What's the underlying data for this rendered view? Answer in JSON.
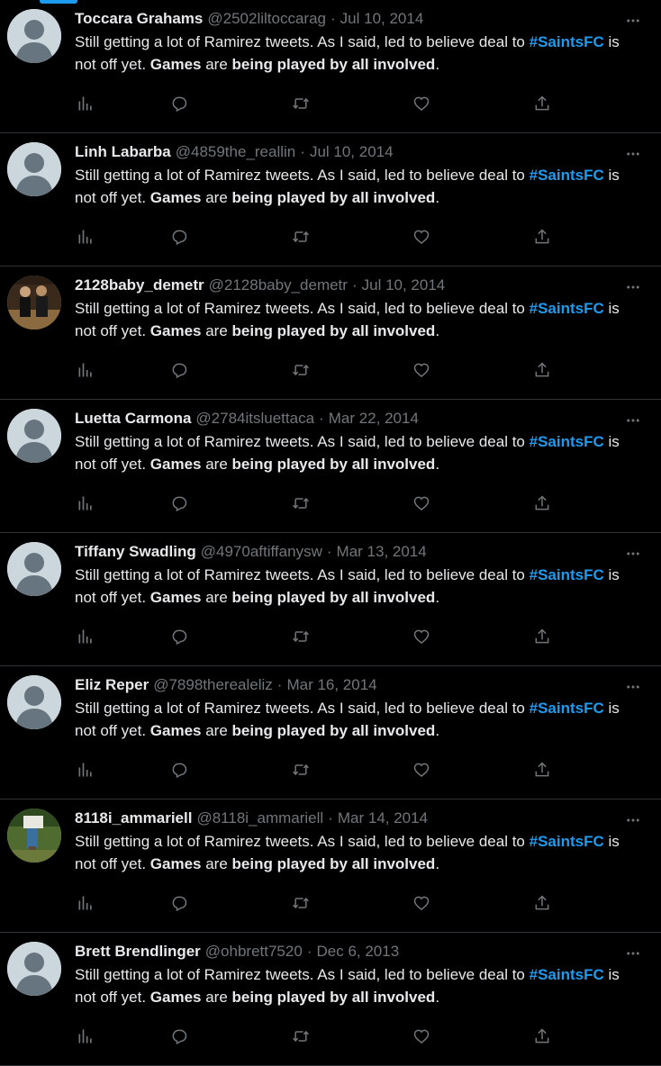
{
  "colors": {
    "background": "#000000",
    "text": "#e7e9ea",
    "muted": "#71767b",
    "accent": "#1d9bf0",
    "divider": "#2f3336"
  },
  "icons": {
    "more": "more-options-icon",
    "views": "analytics-icon",
    "reply": "reply-icon",
    "retweet": "retweet-icon",
    "like": "like-icon",
    "share": "share-icon"
  },
  "separator": "·",
  "tweets": [
    {
      "name": "Toccara Grahams",
      "handle": "@2502liltoccarag",
      "date": "Jul 10, 2014",
      "avatar": "default",
      "text": {
        "p1": "Still getting a lot of Ramirez tweets. As I said, led to believe deal to ",
        "hashtag": "#SaintsFC",
        "p2": " is not off yet. ",
        "b1": "Games",
        "p3": " are ",
        "b2": "being played by all involved",
        "p4": "."
      }
    },
    {
      "name": "Linh Labarba",
      "handle": "@4859the_reallin",
      "date": "Jul 10, 2014",
      "avatar": "default",
      "text": {
        "p1": "Still getting a lot of Ramirez tweets. As I said, led to believe deal to ",
        "hashtag": "#SaintsFC",
        "p2": " is not off yet. ",
        "b1": "Games",
        "p3": " are ",
        "b2": "being played by all involved",
        "p4": "."
      }
    },
    {
      "name": "2128baby_demetr",
      "handle": "@2128baby_demetr",
      "date": "Jul 10, 2014",
      "avatar": "photo-people",
      "text": {
        "p1": "Still getting a lot of Ramirez tweets. As I said, led to believe deal to ",
        "hashtag": "#SaintsFC",
        "p2": " is not off yet. ",
        "b1": "Games",
        "p3": " are ",
        "b2": "being played by all involved",
        "p4": "."
      }
    },
    {
      "name": "Luetta Carmona",
      "handle": "@2784itsluettaca",
      "date": "Mar 22, 2014",
      "avatar": "default",
      "text": {
        "p1": "Still getting a lot of Ramirez tweets. As I said, led to believe deal to ",
        "hashtag": "#SaintsFC",
        "p2": " is not off yet. ",
        "b1": "Games",
        "p3": " are ",
        "b2": "being played by all involved",
        "p4": "."
      }
    },
    {
      "name": "Tiffany Swadling",
      "handle": "@4970aftiffanysw",
      "date": "Mar 13, 2014",
      "avatar": "default",
      "text": {
        "p1": "Still getting a lot of Ramirez tweets. As I said, led to believe deal to ",
        "hashtag": "#SaintsFC",
        "p2": " is not off yet. ",
        "b1": "Games",
        "p3": " are ",
        "b2": "being played by all involved",
        "p4": "."
      }
    },
    {
      "name": "Eliz Reper",
      "handle": "@7898therealeliz",
      "date": "Mar 16, 2014",
      "avatar": "default",
      "text": {
        "p1": "Still getting a lot of Ramirez tweets. As I said, led to believe deal to ",
        "hashtag": "#SaintsFC",
        "p2": " is not off yet. ",
        "b1": "Games",
        "p3": " are ",
        "b2": "being played by all involved",
        "p4": "."
      }
    },
    {
      "name": "8118i_ammariell",
      "handle": "@8118i_ammariell",
      "date": "Mar 14, 2014",
      "avatar": "photo-outdoor",
      "text": {
        "p1": "Still getting a lot of Ramirez tweets. As I said, led to believe deal to ",
        "hashtag": "#SaintsFC",
        "p2": " is not off yet. ",
        "b1": "Games",
        "p3": " are ",
        "b2": "being played by all involved",
        "p4": "."
      }
    },
    {
      "name": "Brett Brendlinger",
      "handle": "@ohbrett7520",
      "date": "Dec 6, 2013",
      "avatar": "default",
      "text": {
        "p1": "Still getting a lot of Ramirez tweets. As I said, led to believe deal to ",
        "hashtag": "#SaintsFC",
        "p2": " is not off yet. ",
        "b1": "Games",
        "p3": " are ",
        "b2": "being played by all involved",
        "p4": "."
      }
    }
  ]
}
